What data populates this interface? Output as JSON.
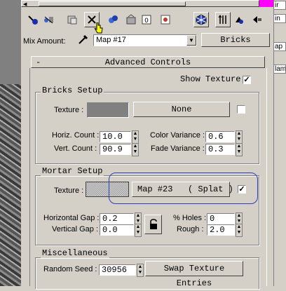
{
  "toolbar": {
    "icons": [
      "pick-material-icon",
      "put-material-icon",
      "assign-material-icon",
      "delete-material-icon",
      "make-unique-icon",
      "put-to-library-icon",
      "material-id-icon",
      "show-map-icon",
      "show-end-result-icon",
      "go-to-parent-icon",
      "go-forward-icon"
    ]
  },
  "mix": {
    "label": "Mix Amount:",
    "map_name": "Map #17",
    "map_type": "Bricks"
  },
  "rollout": {
    "collapse_glyph": "-",
    "title": "Advanced Controls",
    "show_texture_label": "Show Texture",
    "show_texture_checked": "✓"
  },
  "bricks_setup": {
    "title": "Bricks Setup",
    "texture_label": "Texture :",
    "texture_color": "#808080",
    "texture_button": "None",
    "horiz_count_label": "Horiz. Count :",
    "horiz_count": "10.0",
    "vert_count_label": "Vert. Count :",
    "vert_count": "90.9",
    "color_variance_label": "Color Variance :",
    "color_variance": "0.6",
    "fade_variance_label": "Fade Variance :",
    "fade_variance": "0.3"
  },
  "mortar_setup": {
    "title": "Mortar Setup",
    "texture_label": "Texture :",
    "texture_button": "Map #23   ( Splat )",
    "texture_checked": "✓",
    "horizontal_gap_label": "Horizontal Gap :",
    "horizontal_gap": "0.2",
    "vertical_gap_label": "Vertical Gap :",
    "vertical_gap": "0.0",
    "holes_label": "% Holes :",
    "holes": "0",
    "rough_label": "Rough :",
    "rough": "2.0"
  },
  "misc": {
    "title": "Miscellaneous",
    "random_seed_label": "Random Seed :",
    "random_seed": "30956",
    "swap_button": "Swap Texture Entries"
  },
  "right_edge": {
    "tab_texts": [
      "ir",
      "in",
      "ap",
      "lam"
    ]
  },
  "highlight_color": "#2a3fb8"
}
